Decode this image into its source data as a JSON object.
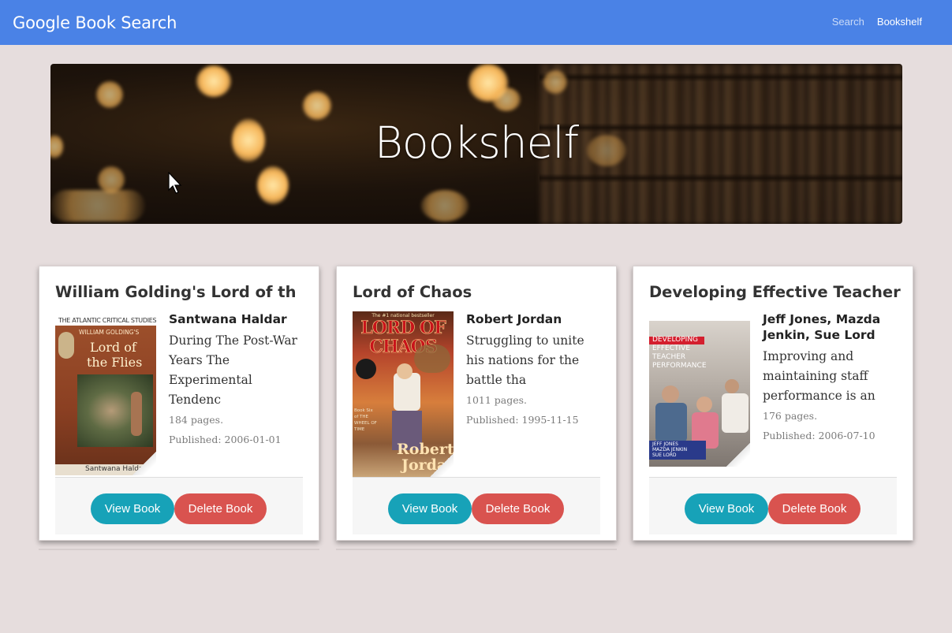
{
  "navbar": {
    "brand": "Google Book Search",
    "links": [
      {
        "label": "Search",
        "active": false
      },
      {
        "label": "Bookshelf",
        "active": true
      }
    ],
    "color": "#4a82e6"
  },
  "hero": {
    "title": "Bookshelf"
  },
  "books": [
    {
      "title": "William Golding's Lord of th",
      "author": "Santwana Haldar",
      "description": "During The Post-War Years The Experimental Tendenc",
      "pages": "184 pages.",
      "published": "Published: 2006-01-01",
      "cover": {
        "series": "The Atlantic Critical Studies",
        "subtitle": "William Golding's",
        "title_line1": "Lord of",
        "title_line2": "the Flies",
        "author": "Santwana Haldar"
      },
      "view_label": "View Book",
      "delete_label": "Delete Book"
    },
    {
      "title": "Lord of Chaos",
      "author": "Robert Jordan",
      "description": "Struggling to unite his nations for the battle tha",
      "pages": "1011 pages.",
      "published": "Published: 1995-11-15",
      "cover": {
        "tagline": "The #1 national bestseller",
        "title_line1": "LORD OF",
        "title_line2": "CHAOS",
        "side_text": "Book Six of THE WHEEL OF TIME",
        "author_line1": "Robert",
        "author_line2": "Jordan"
      },
      "view_label": "View Book",
      "delete_label": "Delete Book"
    },
    {
      "title": "Developing Effective Teacher",
      "author": "Jeff Jones, Mazda Jenkin, Sue Lord",
      "description": "Improving and maintaining staff performance is an",
      "pages": "176 pages.",
      "published": "Published: 2006-07-10",
      "cover": {
        "title_line1": "DEVELOPING",
        "title_line2": "EFFECTIVE",
        "title_line3": "TEACHER",
        "title_line4": "PERFORMANCE",
        "authors_line1": "JEFF JONES",
        "authors_line2": "MAZDA JENKIN",
        "authors_line3": "SUE LORD"
      },
      "view_label": "View Book",
      "delete_label": "Delete Book"
    }
  ],
  "colors": {
    "background": "#e6dddd",
    "view_button": "#17a2b8",
    "delete_button": "#d9534f"
  }
}
